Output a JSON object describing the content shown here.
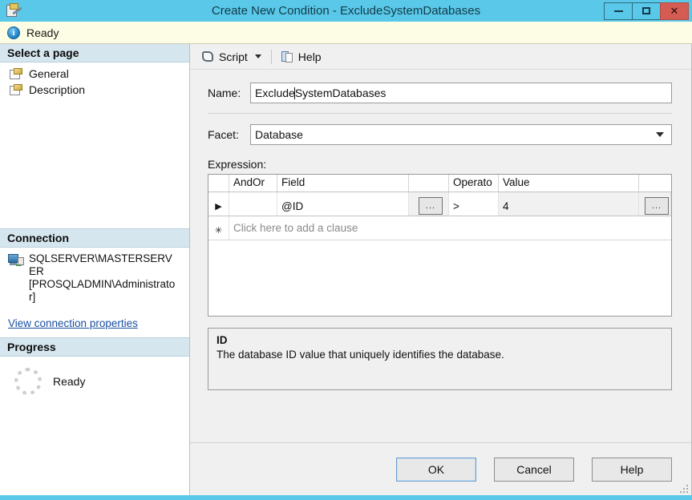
{
  "window": {
    "title": "Create New Condition - ExcludeSystemDatabases",
    "app_icon": "condition-icon",
    "minimize_label": "Minimize",
    "maximize_label": "Maximize",
    "close_label": "Close",
    "close_glyph": "✕"
  },
  "status": {
    "icon": "info-icon",
    "glyph": "i",
    "text": "Ready"
  },
  "sidebar": {
    "select_page_header": "Select a page",
    "pages": [
      {
        "label": "General",
        "icon": "page-icon"
      },
      {
        "label": "Description",
        "icon": "page-icon"
      }
    ],
    "connection_header": "Connection",
    "connection_server": "SQLSERVER\\MASTERSERVER [PROSQLADMIN\\Administrator]",
    "connection_link": "View connection properties",
    "progress_header": "Progress",
    "progress_text": "Ready"
  },
  "toolbar": {
    "script_label": "Script",
    "script_icon": "script-icon",
    "help_label": "Help",
    "help_icon": "help-icon"
  },
  "form": {
    "name_label": "Name:",
    "name_value_before_caret": "Exclude",
    "name_value_after_caret": "SystemDatabases",
    "name_value": "ExcludeSystemDatabases",
    "facet_label": "Facet:",
    "facet_value": "Database",
    "expression_label": "Expression:"
  },
  "grid": {
    "columns": [
      "",
      "AndOr",
      "Field",
      "",
      "Operato",
      "Value",
      ""
    ],
    "rows": [
      {
        "marker": "▶",
        "andor": "",
        "field": "@ID",
        "field_button": "...",
        "operator": ">",
        "value": "4",
        "value_button": "..."
      }
    ],
    "new_row_marker": "✳",
    "new_row_placeholder": "Click here to add a clause"
  },
  "description": {
    "title": "ID",
    "text": "The database ID value that uniquely identifies the database."
  },
  "footer": {
    "ok_label": "OK",
    "cancel_label": "Cancel",
    "help_label": "Help"
  },
  "colors": {
    "titlebar": "#5ac8e8",
    "close_button": "#d55c52",
    "status_bg": "#fdfce4",
    "panel_header": "#d6e6ef",
    "link": "#1a4fa0"
  }
}
